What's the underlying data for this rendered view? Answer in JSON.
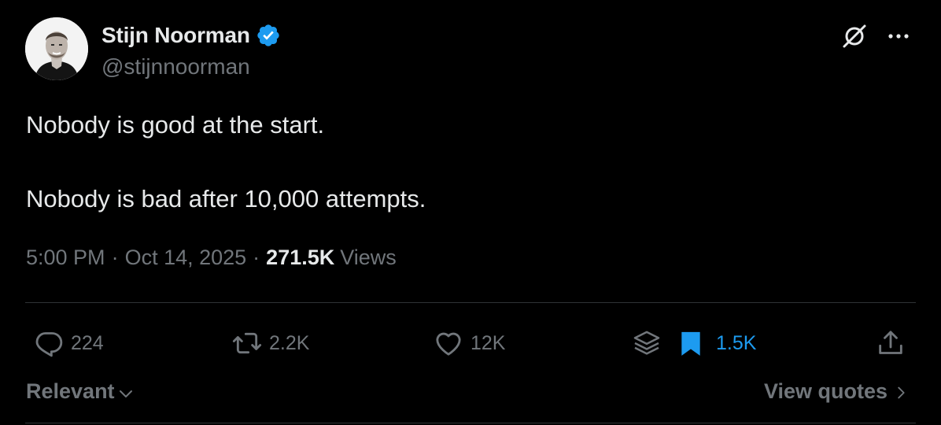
{
  "author": {
    "display_name": "Stijn Noorman",
    "handle": "@stijnnoorman",
    "verified": true,
    "verified_color": "#1d9bf0"
  },
  "tweet": {
    "lines": [
      "Nobody is good at the start.",
      "Nobody is bad after 10,000 attempts."
    ]
  },
  "meta": {
    "time": "5:00 PM",
    "separator": "·",
    "date": "Oct 14, 2025",
    "views_count": "271.5K",
    "views_label": "Views"
  },
  "actions": {
    "replies": "224",
    "reposts": "2.2K",
    "likes": "12K",
    "bookmarks": "1.5K"
  },
  "footer": {
    "sort_label": "Relevant",
    "view_quotes_label": "View quotes"
  },
  "colors": {
    "background": "#000000",
    "primary_text": "#e7e9ea",
    "secondary_text": "#71767b",
    "accent": "#1d9bf0",
    "divider": "#2f3336"
  }
}
